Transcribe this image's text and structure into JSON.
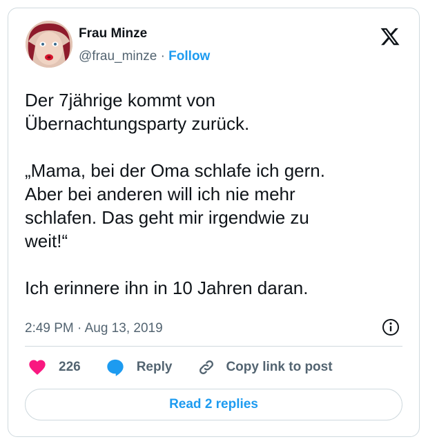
{
  "author": {
    "name": "Frau Minze",
    "handle": "@frau_minze",
    "separator": "·",
    "follow_label": "Follow"
  },
  "post": {
    "text": "Der 7jährige kommt von\nÜbernachtungsparty zurück.\n\n„Mama, bei der Oma schlafe ich gern.\nAber bei anderen will ich nie mehr\nschlafen. Das geht mir irgendwie zu\nweit!“\n\nIch erinnere ihn in 10 Jahren daran.",
    "timestamp": "2:49 PM · Aug 13, 2019"
  },
  "actions": {
    "likes_count": "226",
    "reply_label": "Reply",
    "copy_link_label": "Copy link to post",
    "read_replies_label": "Read 2 replies"
  },
  "icons": {
    "logo": "x-logo-icon",
    "info": "info-icon",
    "like": "heart-icon",
    "reply": "speech-bubble-icon",
    "copy": "link-icon"
  },
  "colors": {
    "accent": "#1d9bf0",
    "like": "#f91880",
    "secondary_text": "#536471",
    "border": "#cfd9de"
  }
}
